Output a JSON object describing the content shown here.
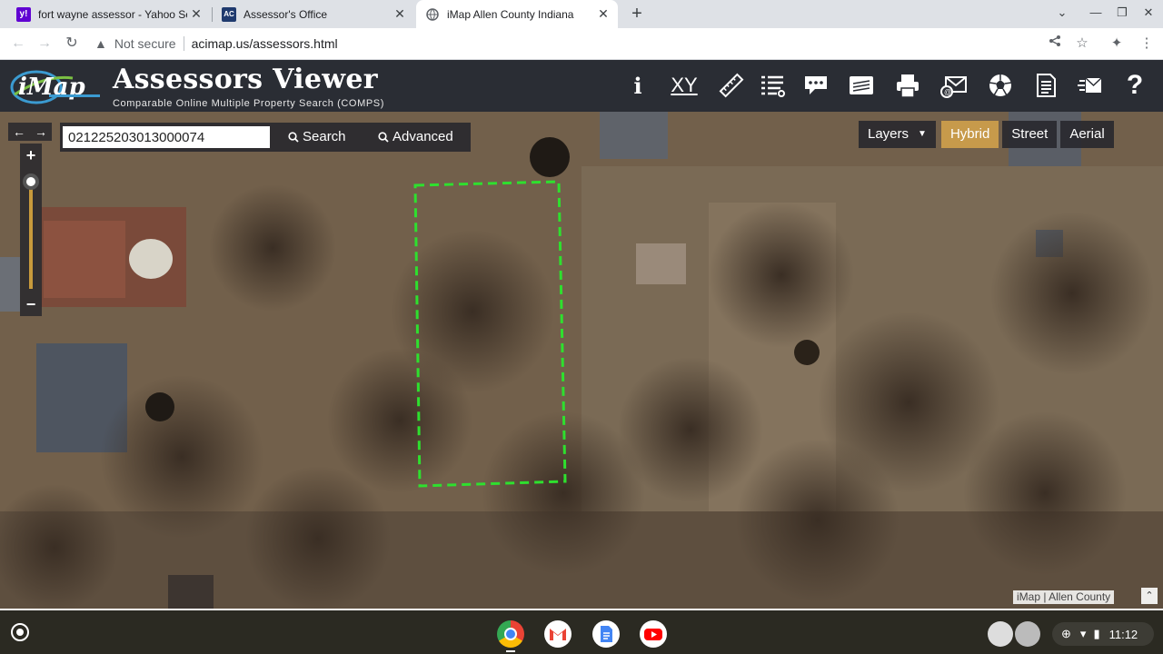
{
  "browser": {
    "tabs": [
      {
        "title": "fort wayne assessor - Yahoo Sea",
        "favicon": "yahoo-icon"
      },
      {
        "title": "Assessor's Office",
        "favicon": "ac-icon"
      },
      {
        "title": "iMap Allen County Indiana",
        "favicon": "globe-icon",
        "active": true
      }
    ],
    "omnibox": {
      "security": "Not secure",
      "url": "acimap.us/assessors.html"
    }
  },
  "app": {
    "logo_text": "iMap",
    "title": "Assessors Viewer",
    "subtitle": "Comparable Online Multiple Property Search (COMPS)",
    "toolbar_icons": [
      "info-icon",
      "xy-icon",
      "ruler-icon",
      "list-icon",
      "comment-icon",
      "layers-card-icon",
      "print-icon",
      "email-icon",
      "soccer-icon",
      "document-icon",
      "send-icon",
      "help-icon"
    ],
    "xy_label": "XY",
    "info_label": "i",
    "help_label": "?"
  },
  "search": {
    "value": "021225203013000074",
    "search_label": "Search",
    "advanced_label": "Advanced"
  },
  "map_controls": {
    "layers_label": "Layers",
    "basemaps": [
      "Hybrid",
      "Street",
      "Aerial"
    ],
    "active_basemap": "Hybrid",
    "zoom_level": 0.1,
    "attribution_left": "iMap",
    "attribution_right": "Allen County"
  },
  "shelf": {
    "time": "11:12",
    "apps": [
      "chrome-icon",
      "gmail-icon",
      "docs-icon",
      "youtube-icon"
    ]
  },
  "colors": {
    "header_bg": "#2a2d34",
    "active_basemap": "#c79a4b",
    "parcel_outline": "#2ee02e"
  }
}
